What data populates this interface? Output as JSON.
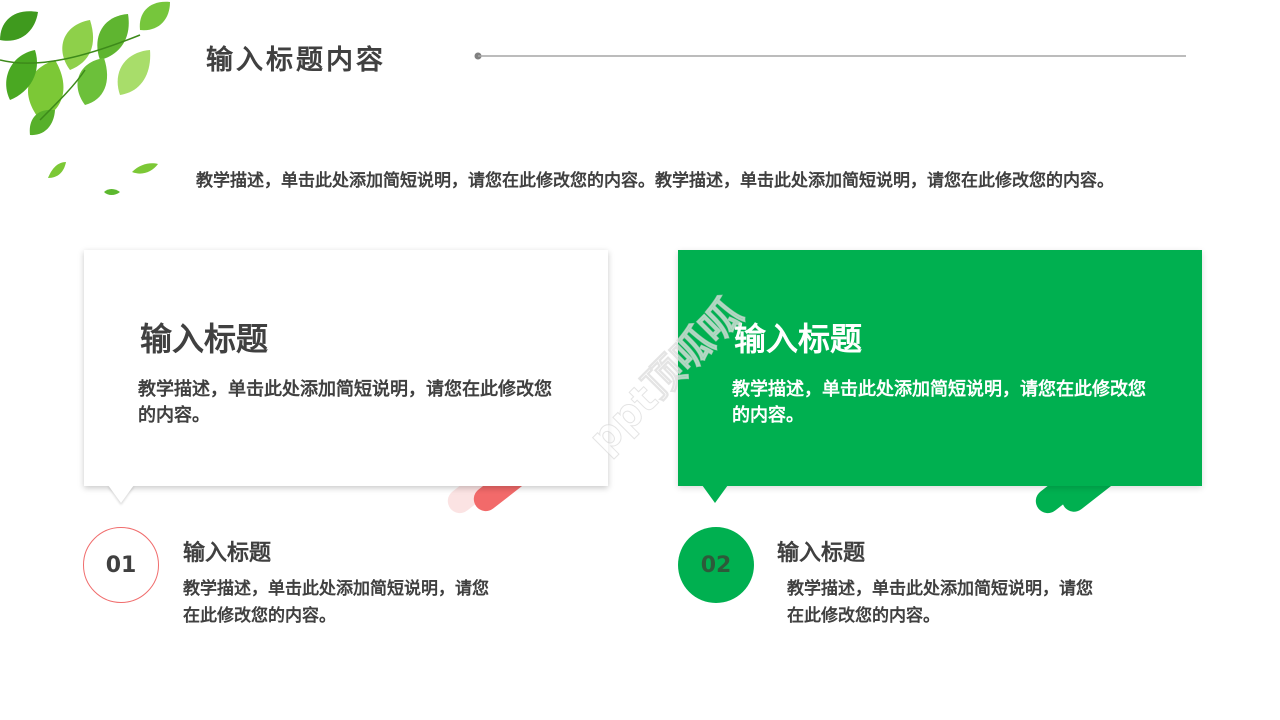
{
  "title": "输入标题内容",
  "intro": "教学描述，单击此处添加简短说明，请您在此修改您的内容。教学描述，单击此处添加简短说明，请您在此修改您的内容。",
  "cards": [
    {
      "title": "输入标题",
      "text": "教学描述，单击此处添加简短说明，请您在此修改您的内容。"
    },
    {
      "title": "输入标题",
      "text": "教学描述，单击此处添加简短说明，请您在此修改您的内容。"
    }
  ],
  "items": [
    {
      "number": "01",
      "title": "输入标题",
      "text": "教学描述，单击此处添加简短说明，请您在此修改您的内容。"
    },
    {
      "number": "02",
      "title": "输入标题",
      "text": "教学描述，单击此处添加简短说明，请您在此修改您的内容。"
    }
  ],
  "watermark": "ppt顶呱呱",
  "colors": {
    "accent_green": "#00b050",
    "accent_red": "#f06c6c",
    "text": "#404040"
  },
  "decoration": {
    "corner": "green-leaves"
  }
}
